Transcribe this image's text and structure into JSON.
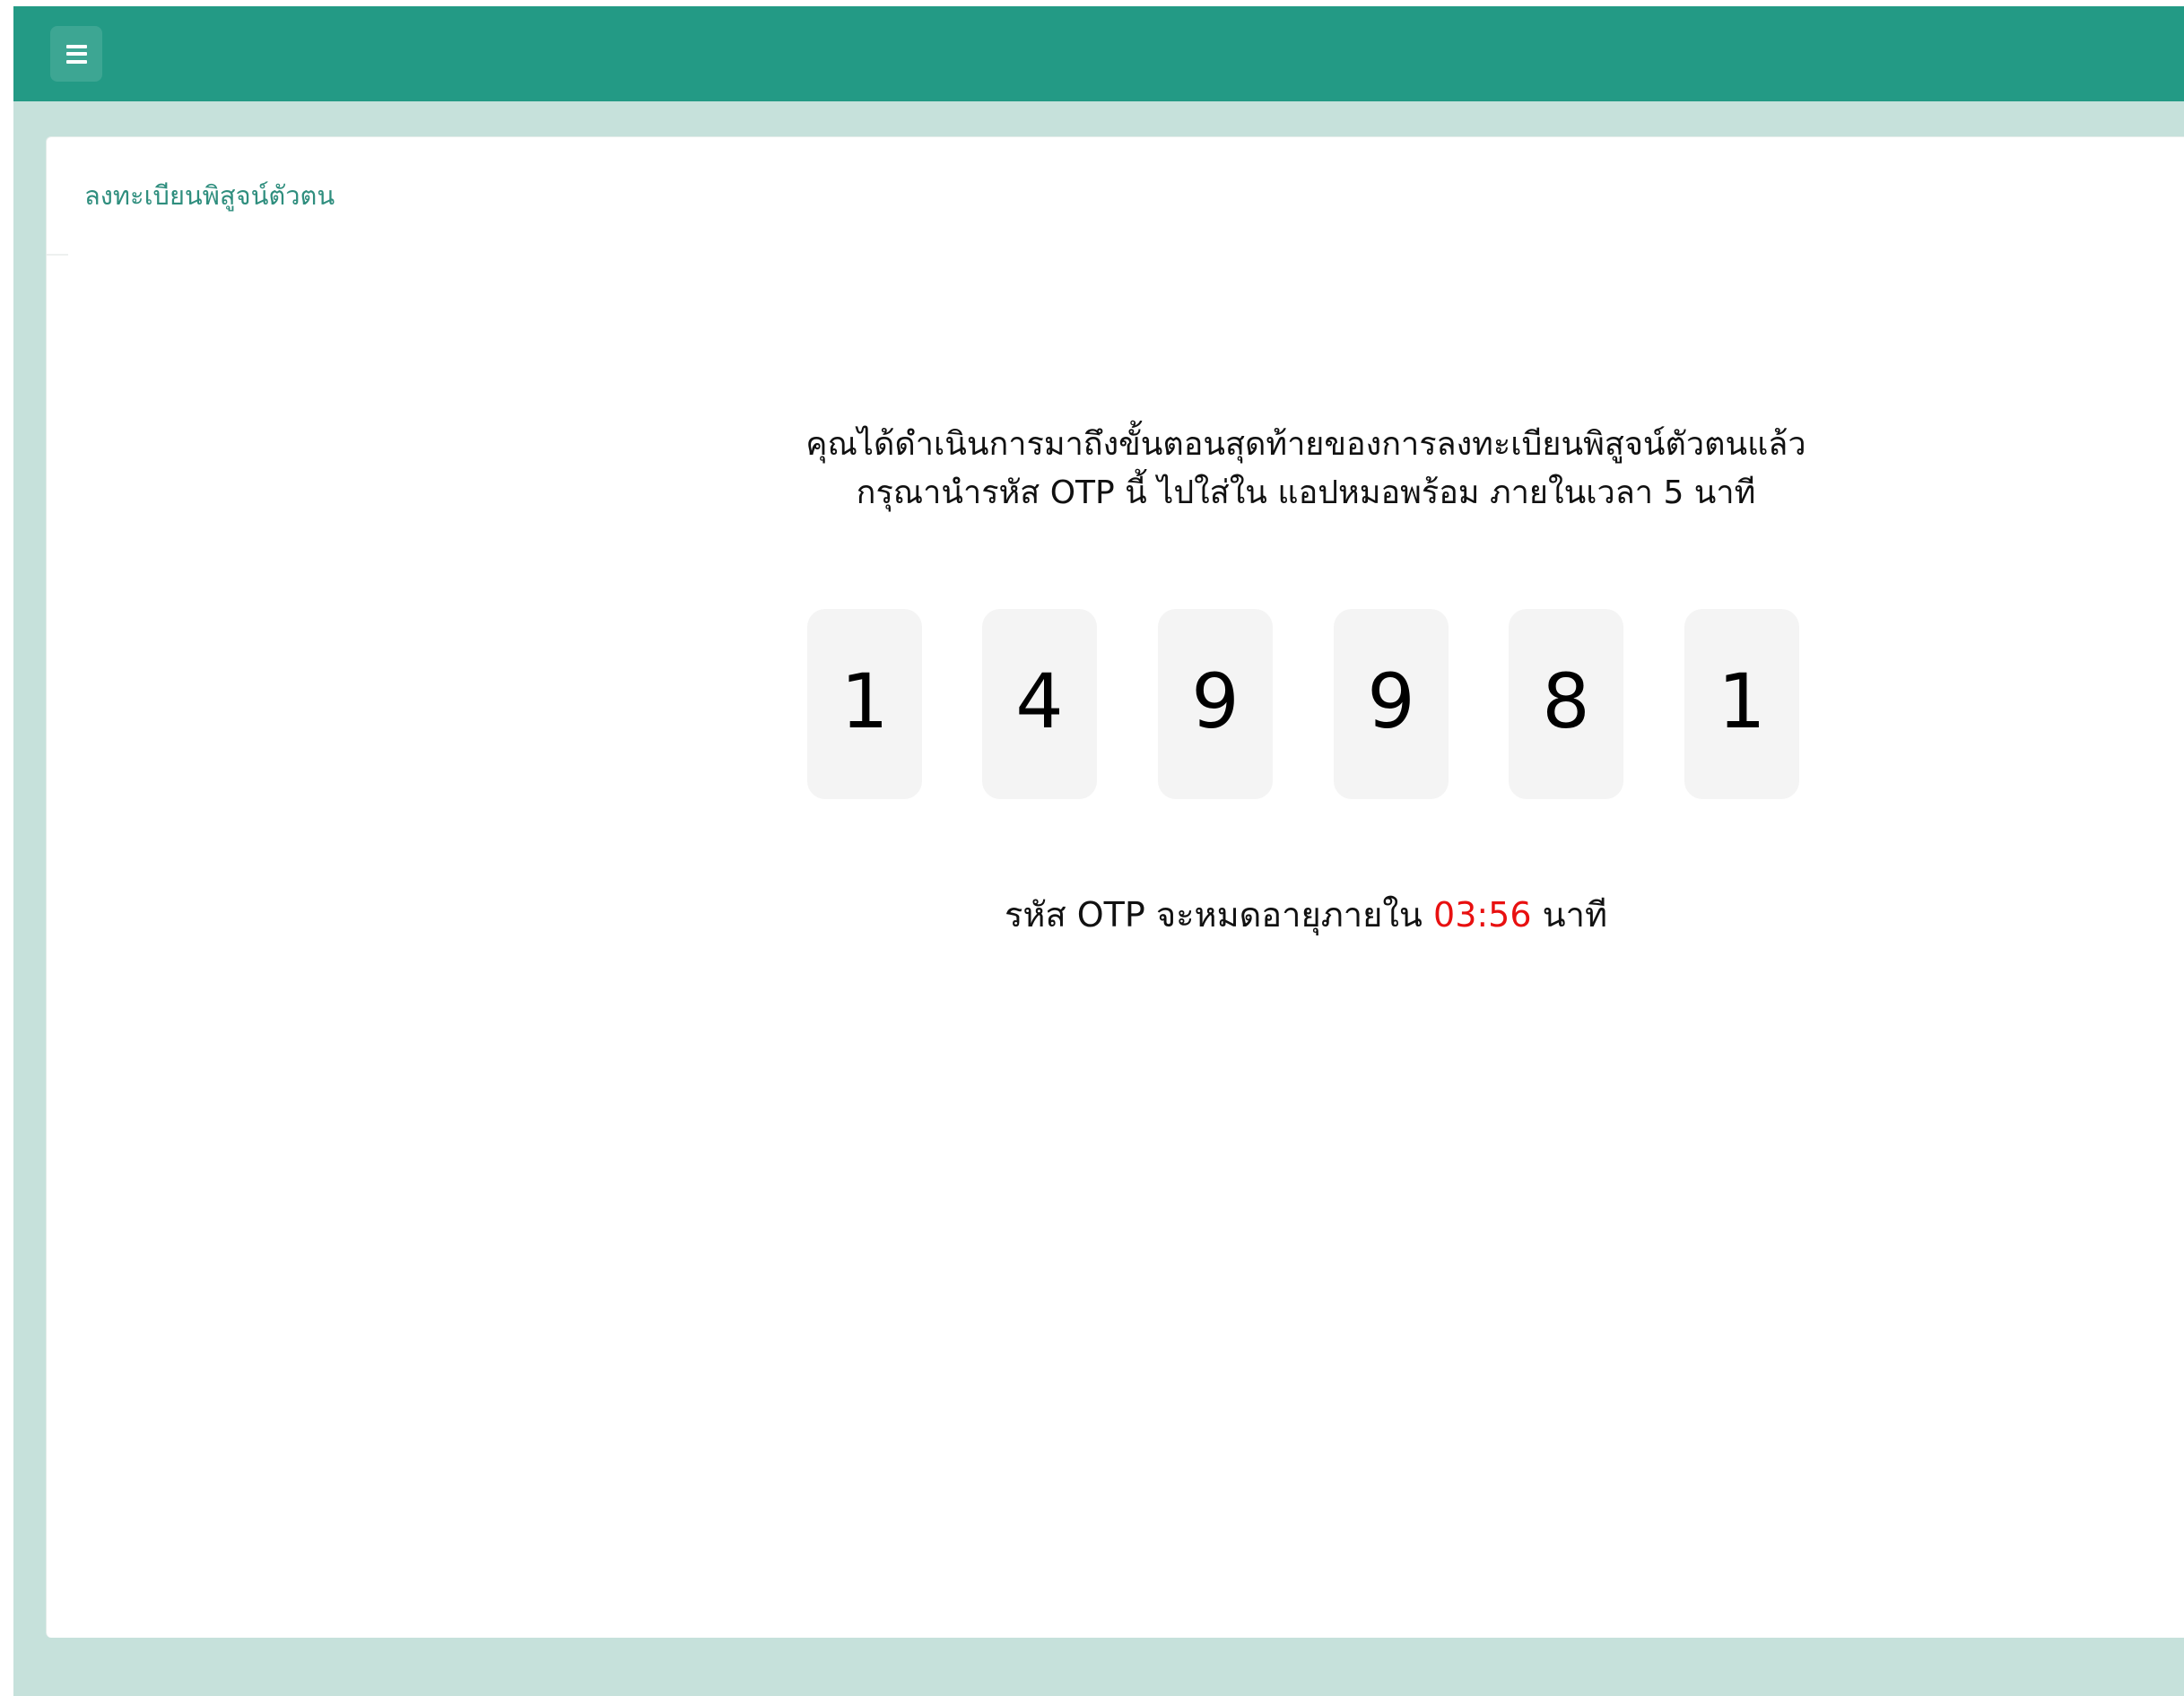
{
  "header": {
    "menu_icon": "hamburger-menu-icon"
  },
  "page": {
    "title": "ลงทะเบียนพิสูจน์ตัวตน"
  },
  "instructions": {
    "line1": "คุณได้ดำเนินการมาถึงขั้นตอนสุดท้ายของการลงทะเบียนพิสูจน์ตัวตนแล้ว",
    "line2": "กรุณานำรหัส OTP นี้ ไปใส่ใน แอปหมอพร้อม ภายในเวลา 5 นาที"
  },
  "otp": {
    "digits": [
      "1",
      "4",
      "9",
      "9",
      "8",
      "1"
    ]
  },
  "expiry": {
    "prefix": "รหัส OTP จะหมดอายุภายใน",
    "countdown": "03:56",
    "suffix": "นาที"
  },
  "colors": {
    "header": "#239a85",
    "background": "#c6e1db",
    "title": "#2f8e7e",
    "countdown": "#e81010",
    "otp_box": "#f4f4f4"
  }
}
